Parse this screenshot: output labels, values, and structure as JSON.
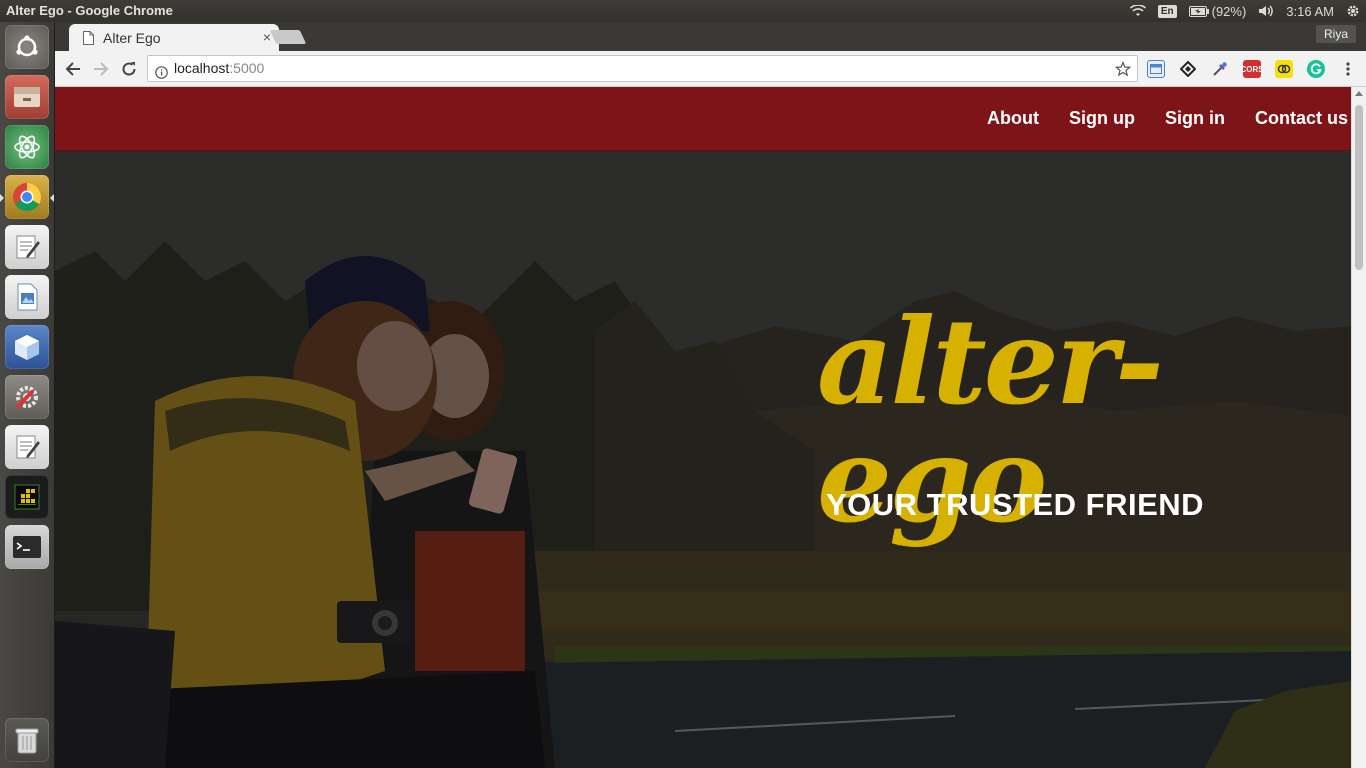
{
  "os": {
    "window_title": "Alter Ego - Google Chrome",
    "tray": {
      "keyboard_layout": "En",
      "battery": "(92%)",
      "time": "3:16 AM"
    }
  },
  "browser": {
    "tab_title": "Alter Ego",
    "tab_close": "×",
    "profile_name": "Riya",
    "url_host": "localhost",
    "url_port": ":5000"
  },
  "site": {
    "nav": [
      "About",
      "Sign up",
      "Sign in",
      "Contact us"
    ],
    "logo": "alter-ego",
    "tagline": "YOUR TRUSTED FRIEND",
    "colors": {
      "nav_bg": "#7d1518",
      "logo": "#d7b100",
      "tagline": "#ffffff"
    }
  }
}
